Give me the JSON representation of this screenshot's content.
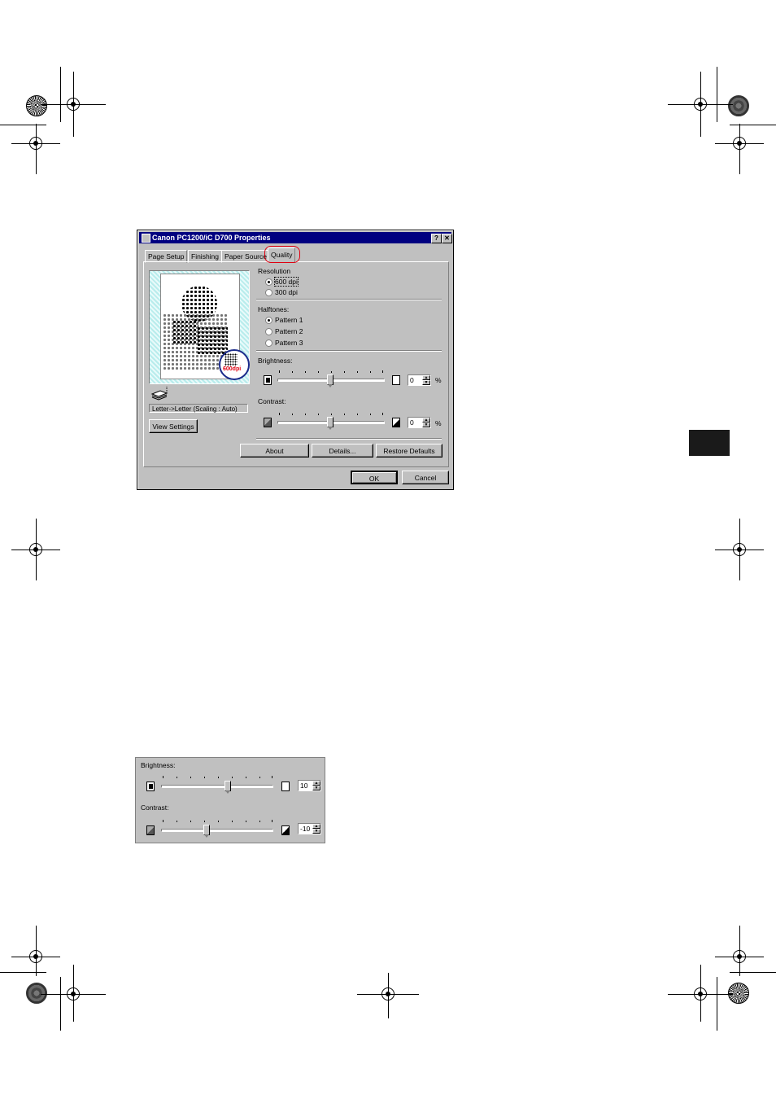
{
  "dialog": {
    "title": "Canon PC1200/iC D700 Properties",
    "help_button": "?",
    "close_button": "✕",
    "tabs": [
      {
        "label": "Page Setup"
      },
      {
        "label": "Finishing"
      },
      {
        "label": "Paper Source"
      },
      {
        "label": "Quality"
      }
    ],
    "active_tab": "Quality",
    "preview": {
      "badge_label": "600dpi",
      "caption": "Letter->Letter (Scaling : Auto)"
    },
    "view_settings_button": "View Settings",
    "resolution": {
      "label": "Resolution",
      "options": [
        "600 dpi",
        "300 dpi"
      ],
      "selected": "600 dpi"
    },
    "halftones": {
      "label": "Halftones:",
      "options": [
        "Pattern 1",
        "Pattern 2",
        "Pattern 3"
      ],
      "selected": "Pattern 1"
    },
    "brightness": {
      "label": "Brightness:",
      "value": "0",
      "unit": "%",
      "slider_level": 0.5
    },
    "contrast": {
      "label": "Contrast:",
      "value": "0",
      "unit": "%",
      "slider_level": 0.5
    },
    "buttons": {
      "about": "About",
      "details": "Details...",
      "restore_defaults": "Restore Defaults",
      "ok": "OK",
      "cancel": "Cancel"
    }
  },
  "closeup": {
    "brightness_label": "Brightness:",
    "brightness_value": "10",
    "brightness_level": 0.6,
    "contrast_label": "Contrast:",
    "contrast_value": "-10",
    "contrast_level": 0.4
  },
  "colors": {
    "title_bar": "#000080",
    "highlight_ring": "#e00010",
    "dialog_face": "#c0c0c0"
  }
}
